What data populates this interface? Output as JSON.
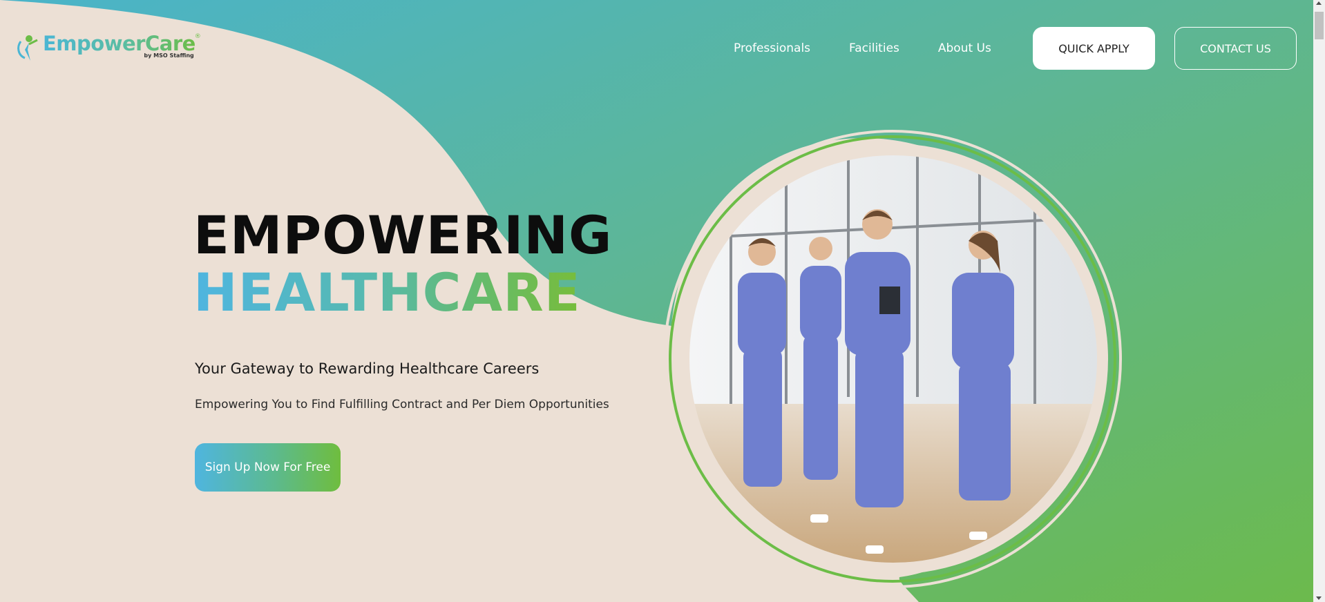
{
  "brand": {
    "name": "EmpowerCare",
    "registered": "®",
    "tagline": "by MSO Staffing"
  },
  "nav": {
    "links": [
      "Professionals",
      "Facilities",
      "About Us"
    ],
    "quick_apply": "QUICK APPLY",
    "contact_us": "CONTACT US"
  },
  "hero": {
    "headline_line1": "EMPOWERING",
    "headline_line2": "HEALTHCARE",
    "subtitle": "Your Gateway to Rewarding Healthcare Careers",
    "description": "Empowering You to Find Fulfilling Contract and Per Diem Opportunities",
    "cta_label": "Sign Up Now For Free",
    "image_icon": "healthcare-team-photo"
  },
  "colors": {
    "cream": "#ece0d5",
    "teal": "#4db8c8",
    "green": "#6cbd47",
    "accent_blue": "#4fb5e0"
  }
}
